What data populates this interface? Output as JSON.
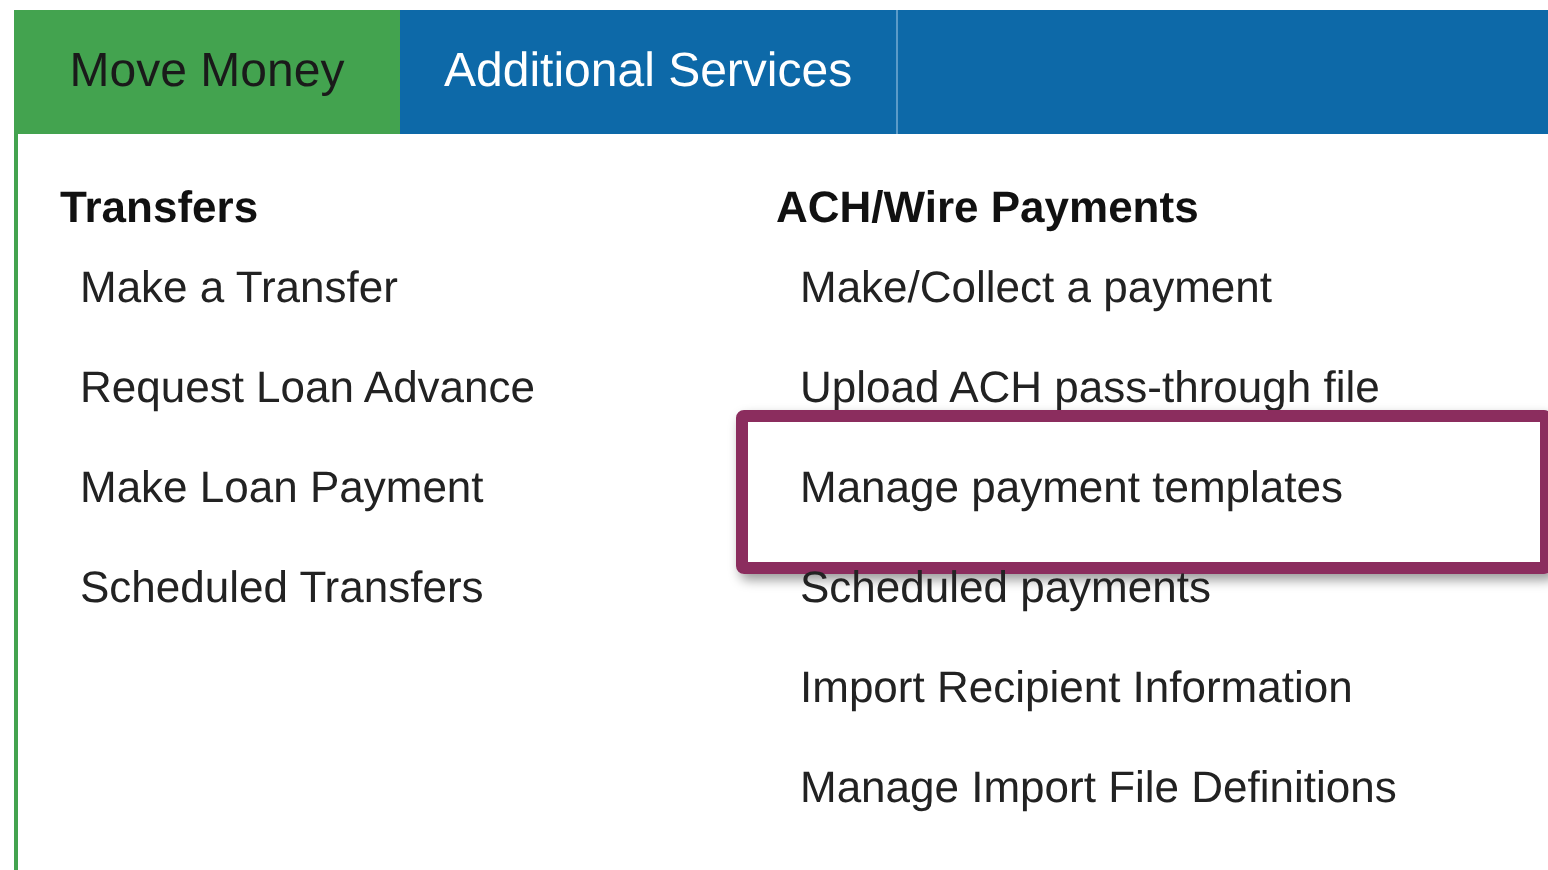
{
  "tabs": [
    {
      "label": "Move Money",
      "selected": true
    },
    {
      "label": "Additional Services",
      "selected": false
    }
  ],
  "columns": [
    {
      "heading": "Transfers",
      "items": [
        {
          "label": "Make a Transfer",
          "highlighted": false
        },
        {
          "label": "Request Loan Advance",
          "highlighted": false
        },
        {
          "label": "Make Loan Payment",
          "highlighted": false
        },
        {
          "label": "Scheduled Transfers",
          "highlighted": false
        }
      ]
    },
    {
      "heading": "ACH/Wire Payments",
      "items": [
        {
          "label": "Make/Collect a payment",
          "highlighted": false
        },
        {
          "label": "Upload ACH pass-through file",
          "highlighted": false
        },
        {
          "label": "Manage payment templates",
          "highlighted": true
        },
        {
          "label": "Scheduled payments",
          "highlighted": false
        },
        {
          "label": "Import Recipient Information",
          "highlighted": false
        },
        {
          "label": "Manage Import File Definitions",
          "highlighted": false
        }
      ]
    }
  ]
}
